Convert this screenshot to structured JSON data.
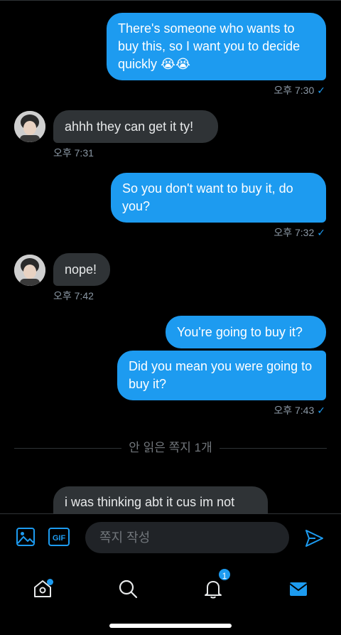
{
  "messages": {
    "m1": {
      "text": "There's someone who wants to buy this, so I want you to decide quickly 😭😭",
      "time": "오후 7:30"
    },
    "m2": {
      "text": "ahhh they can get it ty!",
      "time": "오후 7:31"
    },
    "m3": {
      "text": "So you don't want to buy it, do you?",
      "time": "오후 7:32"
    },
    "m4": {
      "text": "nope!",
      "time": "오후 7:42"
    },
    "m5": {
      "text": "You're going to buy it?"
    },
    "m6": {
      "text": "Did you mean you were going to buy it?",
      "time": "오후 7:43"
    },
    "m7": {
      "text": "i was thinking abt it cus im not"
    }
  },
  "read_check": "✓",
  "unread_divider": "안 읽은 쪽지 1개",
  "composer": {
    "gif_label": "GIF",
    "placeholder": "쪽지 작성"
  },
  "tabbar": {
    "notifications_count": "1"
  },
  "colors": {
    "accent": "#1d9bf0",
    "incoming_bubble": "#2f3336",
    "background": "#000000"
  }
}
